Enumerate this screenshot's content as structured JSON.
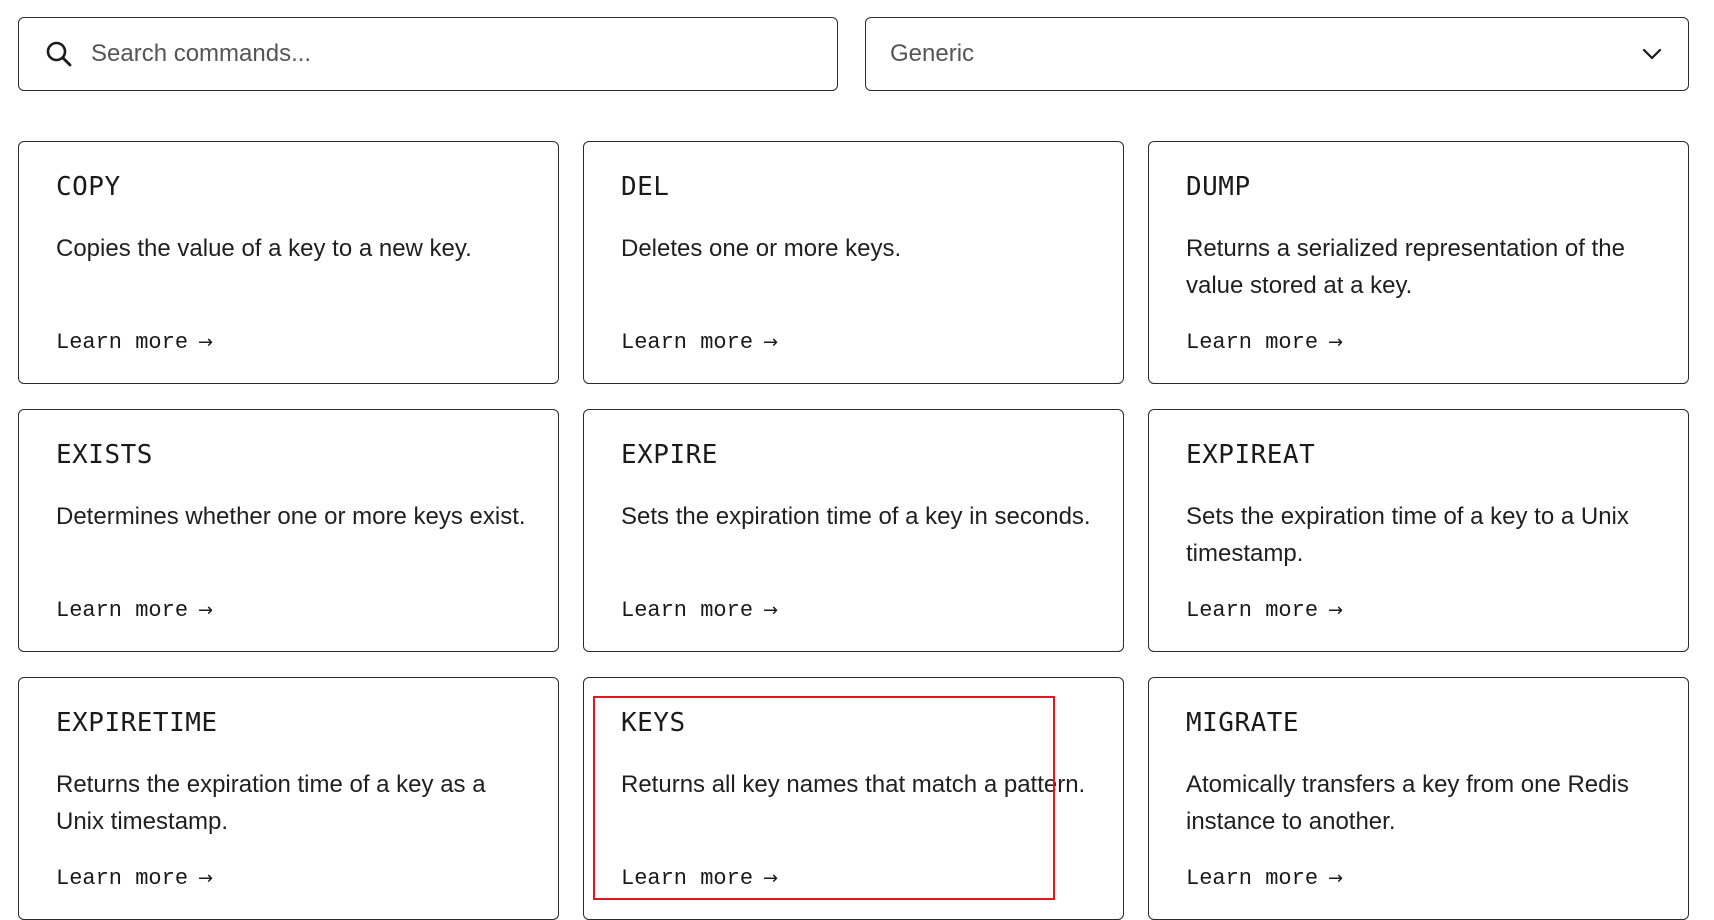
{
  "search": {
    "placeholder": "Search commands...",
    "value": ""
  },
  "filter": {
    "selected": "Generic"
  },
  "cards": [
    {
      "title": "COPY",
      "description": "Copies the value of a key to a new key.",
      "link": "Learn more"
    },
    {
      "title": "DEL",
      "description": "Deletes one or more keys.",
      "link": "Learn more"
    },
    {
      "title": "DUMP",
      "description": "Returns a serialized representation of the value stored at a key.",
      "link": "Learn more"
    },
    {
      "title": "EXISTS",
      "description": "Determines whether one or more keys exist.",
      "link": "Learn more"
    },
    {
      "title": "EXPIRE",
      "description": "Sets the expiration time of a key in seconds.",
      "link": "Learn more"
    },
    {
      "title": "EXPIREAT",
      "description": "Sets the expiration time of a key to a Unix timestamp.",
      "link": "Learn more"
    },
    {
      "title": "EXPIRETIME",
      "description": "Returns the expiration time of a key as a Unix timestamp.",
      "link": "Learn more"
    },
    {
      "title": "KEYS",
      "description": "Returns all key names that match a pattern.",
      "link": "Learn more"
    },
    {
      "title": "MIGRATE",
      "description": "Atomically transfers a key from one Redis instance to another.",
      "link": "Learn more"
    }
  ],
  "icons": {
    "search": "search-icon",
    "chevron": "chevron-down-icon",
    "arrow": "arrow-right-icon"
  },
  "highlight_color": "#e0181e"
}
